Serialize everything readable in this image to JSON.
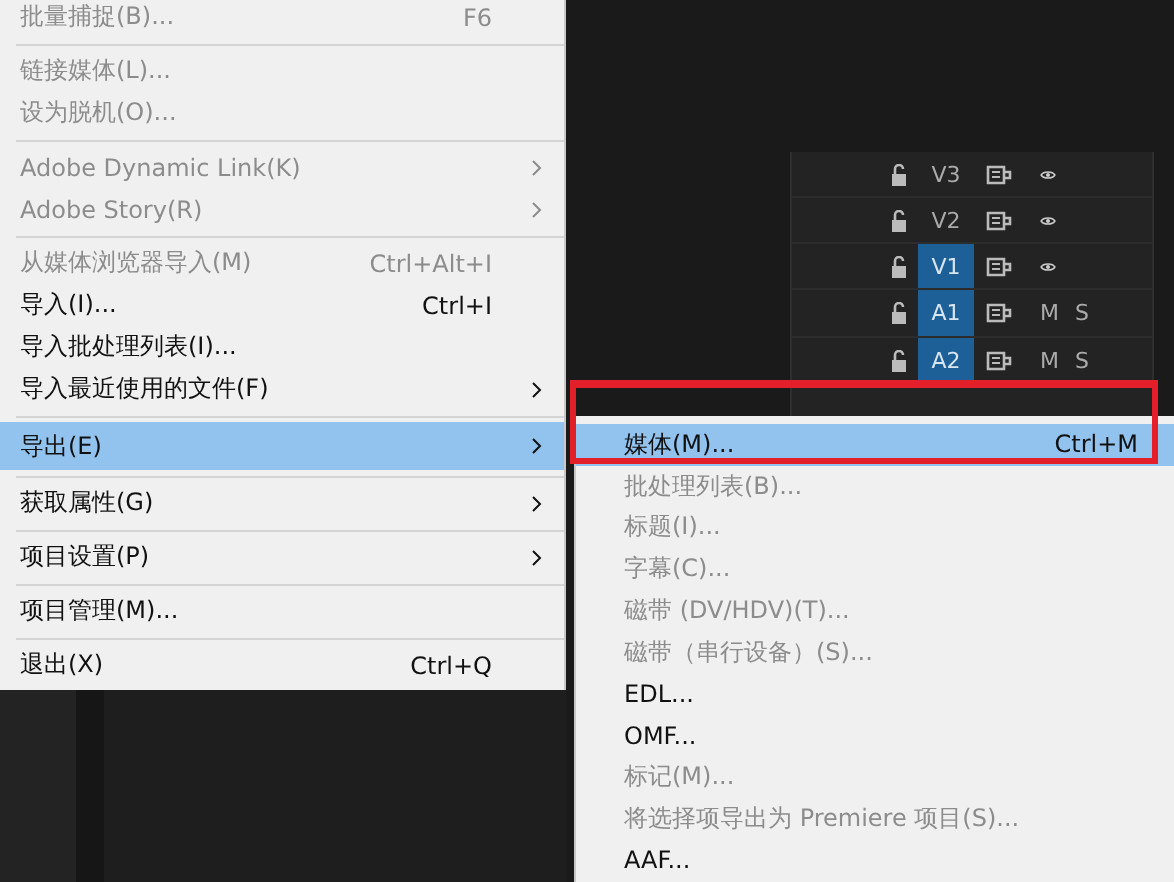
{
  "file_menu": {
    "items": [
      {
        "kind": "item",
        "label": "批量捕捉(B)...",
        "shortcut": "F6",
        "disabled": true,
        "selected": false,
        "submenu": false
      },
      {
        "kind": "separator"
      },
      {
        "kind": "item",
        "label": "链接媒体(L)...",
        "disabled": true,
        "selected": false,
        "submenu": false
      },
      {
        "kind": "item",
        "label": "设为脱机(O)...",
        "disabled": true,
        "selected": false,
        "submenu": false
      },
      {
        "kind": "separator"
      },
      {
        "kind": "item",
        "label": "Adobe Dynamic Link(K)",
        "disabled": true,
        "selected": false,
        "submenu": true
      },
      {
        "kind": "item",
        "label": "Adobe Story(R)",
        "disabled": true,
        "selected": false,
        "submenu": true
      },
      {
        "kind": "separator"
      },
      {
        "kind": "item",
        "label": "从媒体浏览器导入(M)",
        "shortcut": "Ctrl+Alt+I",
        "disabled": true,
        "selected": false,
        "submenu": false
      },
      {
        "kind": "item",
        "label": "导入(I)...",
        "shortcut": "Ctrl+I",
        "disabled": false,
        "selected": false,
        "submenu": false
      },
      {
        "kind": "item",
        "label": "导入批处理列表(I)...",
        "disabled": false,
        "selected": false,
        "submenu": false
      },
      {
        "kind": "item",
        "label": "导入最近使用的文件(F)",
        "disabled": false,
        "selected": false,
        "submenu": true
      },
      {
        "kind": "separator"
      },
      {
        "kind": "item",
        "label": "导出(E)",
        "disabled": false,
        "selected": true,
        "submenu": true
      },
      {
        "kind": "separator"
      },
      {
        "kind": "item",
        "label": "获取属性(G)",
        "disabled": false,
        "selected": false,
        "submenu": true
      },
      {
        "kind": "separator"
      },
      {
        "kind": "item",
        "label": "项目设置(P)",
        "disabled": false,
        "selected": false,
        "submenu": true
      },
      {
        "kind": "separator"
      },
      {
        "kind": "item",
        "label": "项目管理(M)...",
        "disabled": false,
        "selected": false,
        "submenu": false
      },
      {
        "kind": "separator"
      },
      {
        "kind": "item",
        "label": "退出(X)",
        "shortcut": "Ctrl+Q",
        "disabled": false,
        "selected": false,
        "submenu": false
      }
    ]
  },
  "tracks": [
    {
      "label": "V3",
      "kind": "video",
      "selected": false
    },
    {
      "label": "V2",
      "kind": "video",
      "selected": false
    },
    {
      "label": "V1",
      "kind": "video",
      "selected": true
    },
    {
      "label": "A1",
      "kind": "audio",
      "selected": true,
      "mute": "M",
      "solo": "S"
    },
    {
      "label": "A2",
      "kind": "audio",
      "selected": true,
      "mute": "M",
      "solo": "S"
    }
  ],
  "export_submenu": {
    "items": [
      {
        "label": "媒体(M)...",
        "shortcut": "Ctrl+M",
        "disabled": false,
        "selected": true
      },
      {
        "label": "批处理列表(B)...",
        "disabled": true,
        "selected": false
      },
      {
        "label": "标题(I)...",
        "disabled": true,
        "selected": false
      },
      {
        "label": "字幕(C)...",
        "disabled": true,
        "selected": false
      },
      {
        "label": "磁带 (DV/HDV)(T)...",
        "disabled": true,
        "selected": false
      },
      {
        "label": "磁带（串行设备）(S)...",
        "disabled": true,
        "selected": false
      },
      {
        "label": "EDL...",
        "disabled": false,
        "selected": false
      },
      {
        "label": "OMF...",
        "disabled": false,
        "selected": false
      },
      {
        "label": "标记(M)...",
        "disabled": true,
        "selected": false
      },
      {
        "label": "将选择项导出为 Premiere 项目(S)...",
        "disabled": true,
        "selected": false
      },
      {
        "label": "AAF...",
        "disabled": false,
        "selected": false
      }
    ]
  }
}
